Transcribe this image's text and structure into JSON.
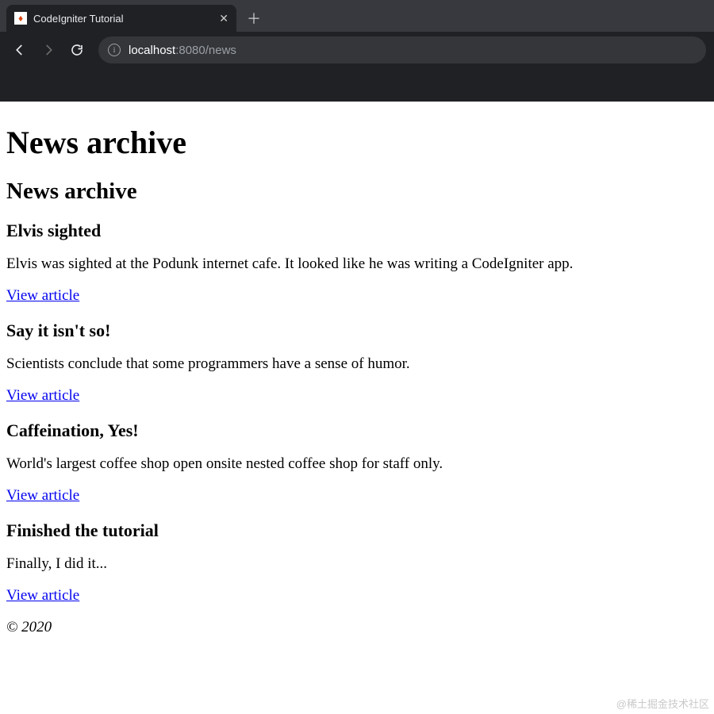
{
  "browser": {
    "tab_title": "CodeIgniter Tutorial",
    "url_host": "localhost",
    "url_port_path": ":8080/news"
  },
  "page": {
    "h1": "News archive",
    "h2": "News archive",
    "articles": [
      {
        "title": "Elvis sighted",
        "body": "Elvis was sighted at the Podunk internet cafe. It looked like he was writing a CodeIgniter app.",
        "link": "View article"
      },
      {
        "title": "Say it isn't so!",
        "body": "Scientists conclude that some programmers have a sense of humor.",
        "link": "View article"
      },
      {
        "title": "Caffeination, Yes!",
        "body": "World's largest coffee shop open onsite nested coffee shop for staff only.",
        "link": "View article"
      },
      {
        "title": "Finished the tutorial",
        "body": "Finally, I did it...",
        "link": "View article"
      }
    ],
    "footer": "© 2020"
  },
  "watermark": "@稀土掘金技术社区"
}
